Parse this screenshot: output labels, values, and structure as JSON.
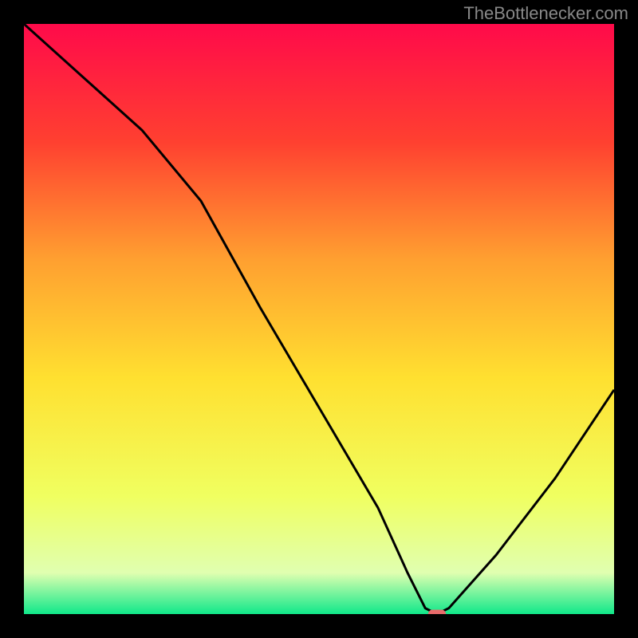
{
  "watermark": "TheBottlenecker.com",
  "chart_data": {
    "type": "line",
    "title": "",
    "xlabel": "",
    "ylabel": "",
    "xlim": [
      0,
      100
    ],
    "ylim": [
      0,
      100
    ],
    "background": {
      "type": "vertical-gradient",
      "stops": [
        {
          "offset": 0,
          "color": "#ff0a4a"
        },
        {
          "offset": 20,
          "color": "#ff4030"
        },
        {
          "offset": 40,
          "color": "#ffa030"
        },
        {
          "offset": 60,
          "color": "#ffe030"
        },
        {
          "offset": 80,
          "color": "#f0ff60"
        },
        {
          "offset": 93,
          "color": "#e0ffb0"
        },
        {
          "offset": 100,
          "color": "#10e88a"
        }
      ]
    },
    "series": [
      {
        "name": "bottleneck-curve",
        "color": "#000000",
        "x": [
          0,
          10,
          20,
          30,
          40,
          50,
          60,
          65,
          68,
          70,
          72,
          80,
          90,
          100
        ],
        "values": [
          100,
          91,
          82,
          70,
          52,
          35,
          18,
          7,
          1,
          0,
          1,
          10,
          23,
          38
        ]
      }
    ],
    "marker": {
      "name": "optimal-point",
      "x": 70,
      "y": 0,
      "color": "#e86a6a",
      "width": 3,
      "height": 1.5
    }
  }
}
